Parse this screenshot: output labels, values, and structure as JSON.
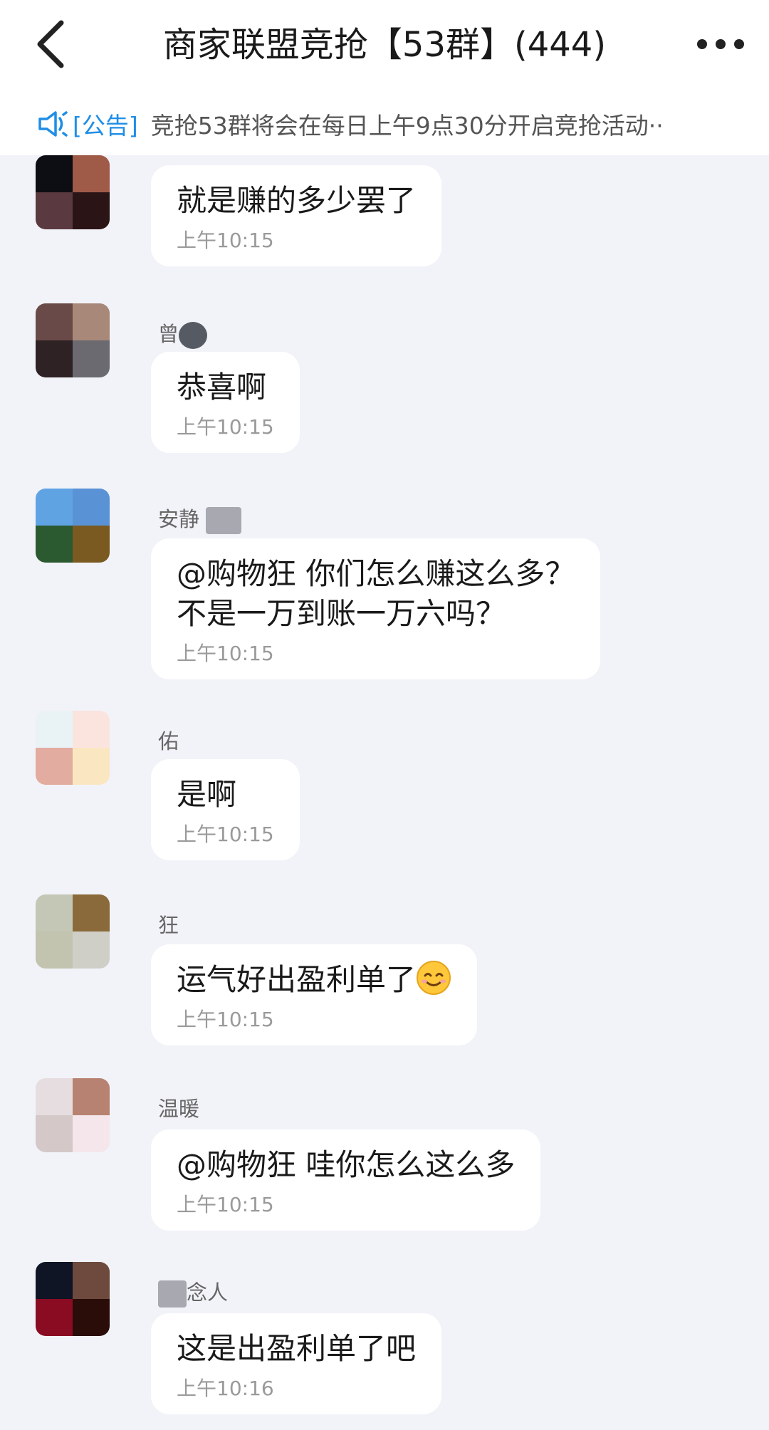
{
  "header": {
    "title": "商家联盟竞抢【53群】(444)",
    "back_icon": "chevron-left-icon",
    "more_icon": "more-dots-icon"
  },
  "notice": {
    "tag": "[公告]",
    "text": "竞抢53群将会在每日上午9点30分开启竞抢活动··"
  },
  "messages": [
    {
      "sender": "",
      "text": "就是赚的多少罢了",
      "time": "上午10:15"
    },
    {
      "sender": "曾",
      "text": "恭喜啊",
      "time": "上午10:15"
    },
    {
      "sender": "安静",
      "text": "@购物狂 你们怎么赚这么多？",
      "text2": "不是一万到账一万六吗？",
      "time": "上午10:15"
    },
    {
      "sender": "佑",
      "text": "是啊",
      "time": "上午10:15"
    },
    {
      "sender": "狂",
      "text": "运气好出盈利单了",
      "time": "上午10:15"
    },
    {
      "sender": "温暖",
      "text": "@购物狂 哇你怎么这么多",
      "time": "上午10:15"
    },
    {
      "sender": "念人",
      "text": "这是出盈利单了吧",
      "time": "上午10:16"
    }
  ],
  "colors": {
    "accent": "#1f8ee6",
    "background": "#f2f3f8"
  }
}
